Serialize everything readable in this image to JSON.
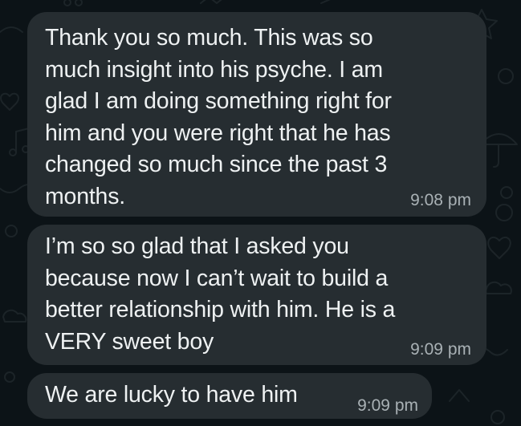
{
  "chat": {
    "messages": [
      {
        "text": "Thank you so much. This was so\nmuch insight into his psyche. I am\nglad I am doing something right for\nhim and you were right that he has\nchanged so much since the past 3\nmonths.",
        "time": "9:08 pm"
      },
      {
        "text": "I’m so so glad that I asked you\nbecause now I can’t wait to build a\nbetter relationship with him. He is a\nVERY sweet boy",
        "time": "9:09 pm"
      },
      {
        "text": "We are lucky to have him",
        "time": "9:09 pm"
      }
    ]
  },
  "colors": {
    "background": "#0c1317",
    "bubble": "#262d31",
    "message_text": "#eef1f2",
    "timestamp": "#a9b1b5",
    "doodle": "#1c2428"
  },
  "wallpaper": {
    "style": "doodle-pattern",
    "icons": [
      "star-doodle-icon",
      "heart-doodle-icon",
      "cloud-doodle-icon",
      "circle-doodle-icon",
      "umbrella-doodle-icon",
      "music-note-doodle-icon"
    ]
  }
}
